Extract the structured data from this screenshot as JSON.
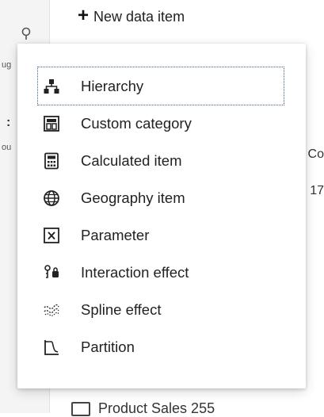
{
  "toolbar": {
    "new_data_item_label": "New data item"
  },
  "background": {
    "left_clip_1": "ug",
    "left_clip_2": ":",
    "left_clip_3": "ou",
    "right_clip_1": "Co",
    "right_clip_2": "17",
    "bottom_item_label": "Product Sales 255"
  },
  "menu": {
    "items": [
      {
        "label": "Hierarchy",
        "icon": "hierarchy-icon",
        "focused": true
      },
      {
        "label": "Custom category",
        "icon": "custom-category-icon"
      },
      {
        "label": "Calculated item",
        "icon": "calculator-icon"
      },
      {
        "label": "Geography item",
        "icon": "globe-icon"
      },
      {
        "label": "Parameter",
        "icon": "parameter-icon"
      },
      {
        "label": "Interaction effect",
        "icon": "interaction-effect-icon"
      },
      {
        "label": "Spline effect",
        "icon": "spline-effect-icon"
      },
      {
        "label": "Partition",
        "icon": "partition-icon"
      }
    ]
  }
}
